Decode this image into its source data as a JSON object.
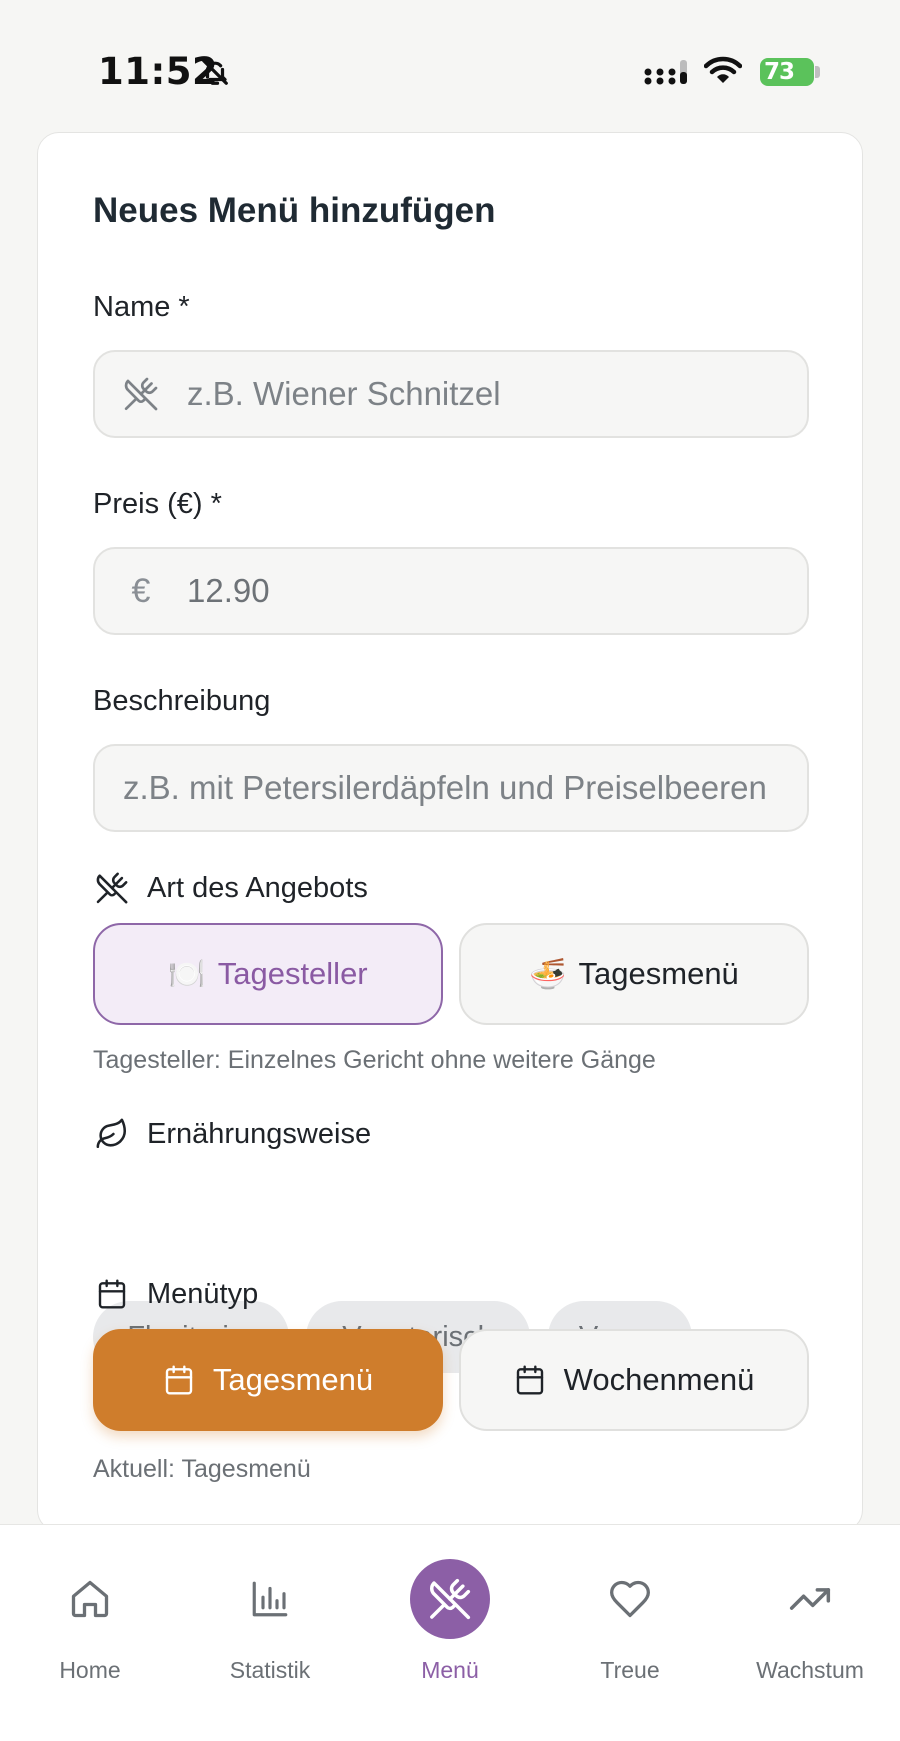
{
  "status_bar": {
    "time": "11:52",
    "battery": "73"
  },
  "form": {
    "title": "Neues Menü hinzufügen",
    "name": {
      "label": "Name *",
      "placeholder": "z.B. Wiener Schnitzel",
      "icon": "utensils-crossed-icon"
    },
    "price": {
      "label": "Preis (€) *",
      "value": "12.90",
      "icon_text": "€"
    },
    "description": {
      "label": "Beschreibung",
      "placeholder": "z.B. mit Petersilerdäpfeln und Preiselbeeren"
    },
    "offer_type": {
      "label": "Art des Angebots",
      "options": [
        {
          "emoji": "🍽️",
          "label": "Tagesteller",
          "selected": true
        },
        {
          "emoji": "🍜",
          "label": "Tagesmenü",
          "selected": false
        }
      ],
      "hint": "Tagesteller: Einzelnes Gericht ohne weitere Gänge"
    },
    "diet": {
      "label": "Ernährungsweise",
      "options": [
        "Flexitarier",
        "Vegetarisch",
        "Vegan"
      ]
    },
    "menu_type": {
      "label": "Menütyp",
      "options": [
        {
          "label": "Tagesmenü",
          "selected": true
        },
        {
          "label": "Wochenmenü",
          "selected": false
        }
      ],
      "hint": "Aktuell: Tagesmenü"
    }
  },
  "colors": {
    "accent_purple": "#8c5fa6",
    "accent_orange": "#cf7d2c"
  },
  "bottom_nav": {
    "items": [
      {
        "label": "Home",
        "icon": "home-icon",
        "active": false
      },
      {
        "label": "Statistik",
        "icon": "bar-chart-icon",
        "active": false
      },
      {
        "label": "Menü",
        "icon": "utensils-crossed-icon",
        "active": true
      },
      {
        "label": "Treue",
        "icon": "heart-icon",
        "active": false
      },
      {
        "label": "Wachstum",
        "icon": "trending-up-icon",
        "active": false
      }
    ]
  }
}
